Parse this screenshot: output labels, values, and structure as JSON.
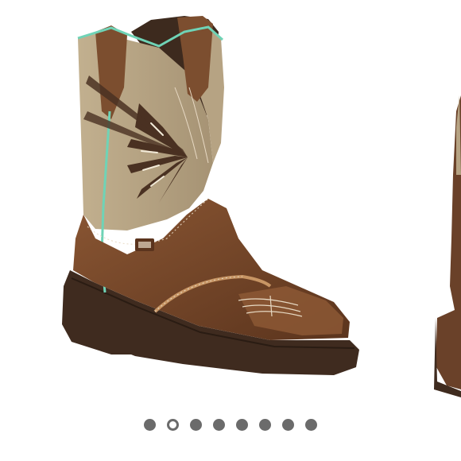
{
  "carousel": {
    "slide_count": 8,
    "active_index": 1,
    "colors": {
      "dot_inactive": "#6b6b6b",
      "dot_active_ring": "#6b6b6b",
      "dot_active_fill": "#ffffff"
    }
  },
  "product_image": {
    "subject": "boot-image",
    "colors": {
      "shaft": "#b6a383",
      "shaft_shadow": "#8f7e62",
      "vamp": "#7a4a2b",
      "vamp_dark": "#5b341d",
      "sole": "#3f2b1f",
      "piping": "#6fd3b6",
      "stitching": "#e7d9c3"
    }
  }
}
